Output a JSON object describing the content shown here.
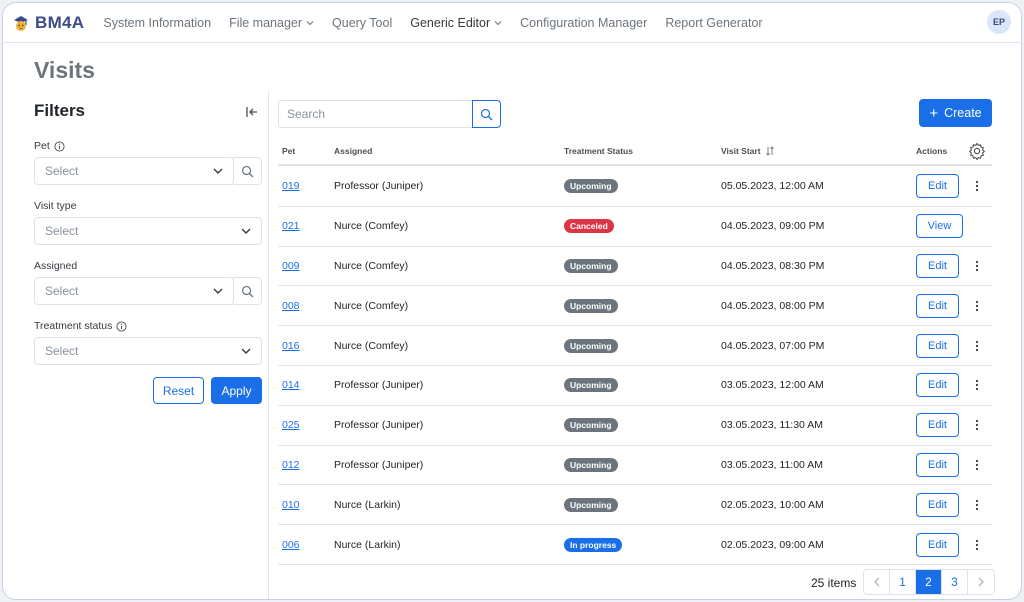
{
  "app": {
    "name": "BM4A",
    "user_initials": "EP"
  },
  "nav": {
    "items": [
      {
        "label": "System Information",
        "dropdown": false
      },
      {
        "label": "File manager",
        "dropdown": true
      },
      {
        "label": "Query Tool",
        "dropdown": false
      },
      {
        "label": "Generic Editor",
        "dropdown": true
      },
      {
        "label": "Configuration Manager",
        "dropdown": false
      },
      {
        "label": "Report Generator",
        "dropdown": false
      }
    ]
  },
  "page": {
    "title": "Visits"
  },
  "filters": {
    "title": "Filters",
    "pet": {
      "label": "Pet",
      "placeholder": "Select"
    },
    "visit_type": {
      "label": "Visit type",
      "placeholder": "Select"
    },
    "assigned": {
      "label": "Assigned",
      "placeholder": "Select"
    },
    "treatment_status": {
      "label": "Treatment status",
      "placeholder": "Select"
    },
    "reset_label": "Reset",
    "apply_label": "Apply"
  },
  "toolbar": {
    "search_placeholder": "Search",
    "create_label": "Create"
  },
  "table": {
    "columns": {
      "pet": "Pet",
      "assigned": "Assigned",
      "status": "Treatment Status",
      "visit": "Visit Start",
      "actions": "Actions"
    },
    "status_colors": {
      "Upcoming": "#6c757d",
      "Canceled": "#dc3545",
      "In progress": "#1a6fe8"
    },
    "rows": [
      {
        "pet": "019",
        "assigned": "Professor (Juniper)",
        "status": "Upcoming",
        "visit": "05.05.2023, 12:00 AM",
        "action": "Edit",
        "menu": true
      },
      {
        "pet": "021",
        "assigned": "Nurce (Comfey)",
        "status": "Canceled",
        "visit": "04.05.2023, 09:00 PM",
        "action": "View",
        "menu": false
      },
      {
        "pet": "009",
        "assigned": "Nurce (Comfey)",
        "status": "Upcoming",
        "visit": "04.05.2023, 08:30 PM",
        "action": "Edit",
        "menu": true
      },
      {
        "pet": "008",
        "assigned": "Nurce (Comfey)",
        "status": "Upcoming",
        "visit": "04.05.2023, 08:00 PM",
        "action": "Edit",
        "menu": true
      },
      {
        "pet": "016",
        "assigned": "Nurce (Comfey)",
        "status": "Upcoming",
        "visit": "04.05.2023, 07:00 PM",
        "action": "Edit",
        "menu": true
      },
      {
        "pet": "014",
        "assigned": "Professor (Juniper)",
        "status": "Upcoming",
        "visit": "03.05.2023, 12:00 AM",
        "action": "Edit",
        "menu": true
      },
      {
        "pet": "025",
        "assigned": "Professor (Juniper)",
        "status": "Upcoming",
        "visit": "03.05.2023, 11:30 AM",
        "action": "Edit",
        "menu": true
      },
      {
        "pet": "012",
        "assigned": "Professor (Juniper)",
        "status": "Upcoming",
        "visit": "03.05.2023, 11:00 AM",
        "action": "Edit",
        "menu": true
      },
      {
        "pet": "010",
        "assigned": "Nurce (Larkin)",
        "status": "Upcoming",
        "visit": "02.05.2023, 10:00 AM",
        "action": "Edit",
        "menu": true
      },
      {
        "pet": "006",
        "assigned": "Nurce (Larkin)",
        "status": "In progress",
        "visit": "02.05.2023, 09:00 AM",
        "action": "Edit",
        "menu": true
      }
    ]
  },
  "pagination": {
    "total": "25 items",
    "pages": [
      "1",
      "2",
      "3"
    ],
    "current": "2"
  }
}
